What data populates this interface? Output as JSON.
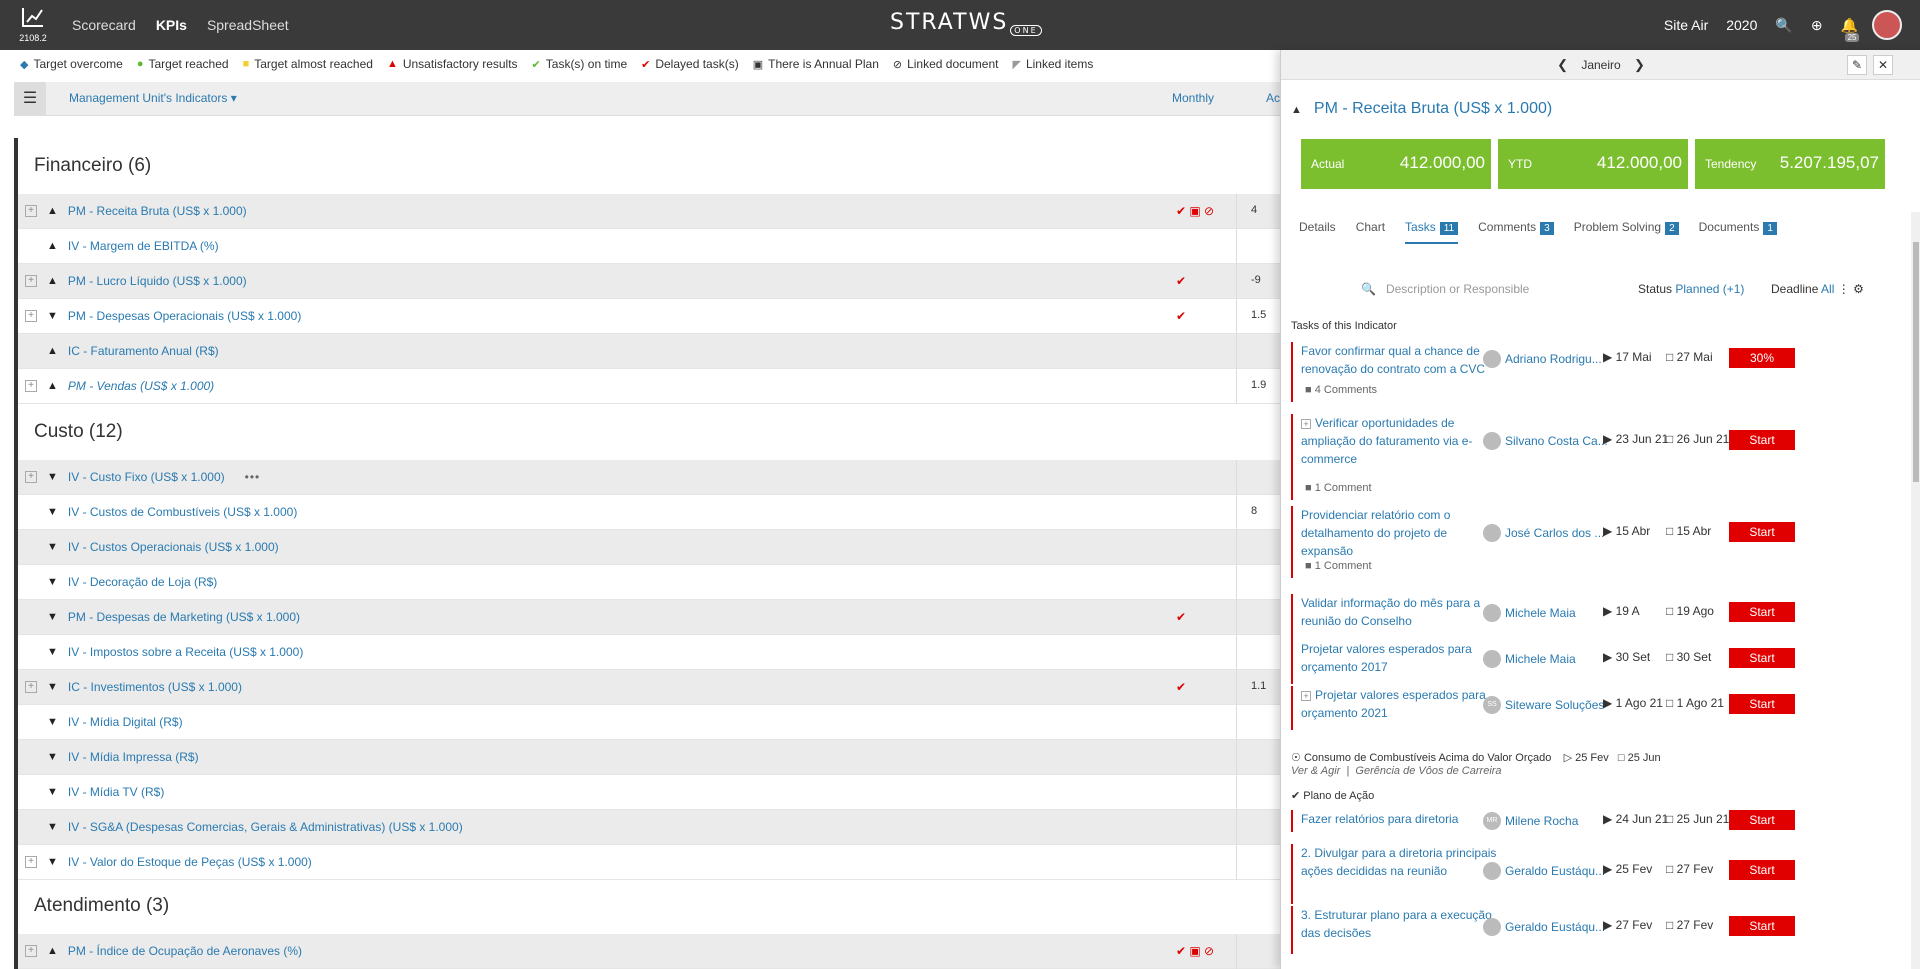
{
  "topbar": {
    "version": "2108.2",
    "nav": [
      "Scorecard",
      "KPIs",
      "SpreadSheet"
    ],
    "brand": "STRATWS",
    "brand_sub": "ONE",
    "site": "Site Air",
    "year": "2020",
    "notif_count": "25"
  },
  "legend": [
    {
      "icon": "◆",
      "color": "#2a7ab0",
      "label": "Target overcome"
    },
    {
      "icon": "●",
      "color": "#5cb82e",
      "label": "Target reached"
    },
    {
      "icon": "■",
      "color": "#f0d030",
      "label": "Target almost reached"
    },
    {
      "icon": "▲",
      "color": "#d00",
      "label": "Unsatisfactory results"
    },
    {
      "icon": "✔",
      "color": "#5cb82e",
      "label": "Task(s) on time"
    },
    {
      "icon": "✔",
      "color": "#d00",
      "label": "Delayed task(s)"
    },
    {
      "icon": "▣",
      "color": "#333",
      "label": "There is Annual Plan"
    },
    {
      "icon": "⊘",
      "color": "#333",
      "label": "Linked document"
    },
    {
      "icon": "◤",
      "color": "#999",
      "label": "Linked items"
    }
  ],
  "toolbar": {
    "unit": "Management Unit's Indicators",
    "period": "Monthly",
    "col": "Ac"
  },
  "sections": [
    {
      "title": "Financeiro (6)",
      "rows": [
        {
          "plus": true,
          "arrow": "▲",
          "name": "PM - Receita Bruta (US$ x 1.000)",
          "grey": true,
          "icons": "✔ ▣ ⊘",
          "val": "4"
        },
        {
          "plus": false,
          "arrow": "▲",
          "name": "IV - Margem de EBITDA (%)",
          "grey": false,
          "icons": "",
          "val": ""
        },
        {
          "plus": true,
          "arrow": "▲",
          "name": "PM - Lucro Líquido (US$ x 1.000)",
          "grey": true,
          "icons": "✔",
          "val": "-9"
        },
        {
          "plus": true,
          "arrow": "▼",
          "name": "PM - Despesas Operacionais (US$ x 1.000)",
          "grey": false,
          "icons": "✔",
          "val": "1.5"
        },
        {
          "plus": false,
          "arrow": "▲",
          "name": "IC - Faturamento Anual (R$)",
          "grey": true,
          "icons": "",
          "val": ""
        },
        {
          "plus": true,
          "arrow": "▲",
          "name": "PM - Vendas (US$ x 1.000)",
          "grey": false,
          "icons": "",
          "val": "1.9",
          "italic": true
        }
      ]
    },
    {
      "title": "Custo (12)",
      "rows": [
        {
          "plus": true,
          "arrow": "▼",
          "name": "IV - Custo Fixo (US$ x 1.000)",
          "grey": true,
          "icons": "",
          "val": "",
          "dots": "•••"
        },
        {
          "plus": false,
          "arrow": "▼",
          "name": "IV - Custos de Combustíveis (US$ x 1.000)",
          "grey": false,
          "icons": "",
          "val": "8"
        },
        {
          "plus": false,
          "arrow": "▼",
          "name": "IV - Custos Operacionais (US$ x 1.000)",
          "grey": true,
          "icons": "",
          "val": ""
        },
        {
          "plus": false,
          "arrow": "▼",
          "name": "IV - Decoração de Loja (R$)",
          "grey": false,
          "icons": "",
          "val": ""
        },
        {
          "plus": false,
          "arrow": "▼",
          "name": "PM - Despesas de Marketing (US$ x 1.000)",
          "grey": true,
          "icons": "✔",
          "val": ""
        },
        {
          "plus": false,
          "arrow": "▼",
          "name": "IV - Impostos sobre a Receita (US$ x 1.000)",
          "grey": false,
          "icons": "",
          "val": ""
        },
        {
          "plus": true,
          "arrow": "▼",
          "name": "IC - Investimentos (US$ x 1.000)",
          "grey": true,
          "icons": "✔",
          "val": "1.1"
        },
        {
          "plus": false,
          "arrow": "▼",
          "name": "IV - Mídia Digital (R$)",
          "grey": false,
          "icons": "",
          "val": ""
        },
        {
          "plus": false,
          "arrow": "▼",
          "name": "IV - Mídia Impressa (R$)",
          "grey": true,
          "icons": "",
          "val": ""
        },
        {
          "plus": false,
          "arrow": "▼",
          "name": "IV - Mídia TV (R$)",
          "grey": false,
          "icons": "",
          "val": ""
        },
        {
          "plus": false,
          "arrow": "▼",
          "name": "IV - SG&A (Despesas Comercias, Gerais & Administrativas) (US$ x 1.000)",
          "grey": true,
          "icons": "",
          "val": ""
        },
        {
          "plus": true,
          "arrow": "▼",
          "name": "IV - Valor do Estoque de Peças (US$ x 1.000)",
          "grey": false,
          "icons": "",
          "val": ""
        }
      ]
    },
    {
      "title": "Atendimento (3)",
      "rows": [
        {
          "plus": true,
          "arrow": "▲",
          "name": "PM - Índice de Ocupação de Aeronaves (%)",
          "grey": true,
          "icons": "✔ ▣ ⊘",
          "val": ""
        }
      ]
    }
  ],
  "panel": {
    "month": "Janeiro",
    "title": "PM - Receita Bruta (US$ x 1.000)",
    "kpis": [
      {
        "label": "Actual",
        "value": "412.000,00"
      },
      {
        "label": "YTD",
        "value": "412.000,00"
      },
      {
        "label": "Tendency",
        "value": "5.207.195,07"
      }
    ],
    "tabs": [
      {
        "label": "Details",
        "num": ""
      },
      {
        "label": "Chart",
        "num": ""
      },
      {
        "label": "Tasks",
        "num": "11"
      },
      {
        "label": "Comments",
        "num": "3"
      },
      {
        "label": "Problem Solving",
        "num": "2"
      },
      {
        "label": "Documents",
        "num": "1"
      }
    ],
    "search_placeholder": "Description or Responsible",
    "status_label": "Status",
    "status_value": "Planned (+1)",
    "deadline_label": "Deadline",
    "deadline_value": "All",
    "tasks_heading": "Tasks of this Indicator",
    "tasks": [
      {
        "title": "Favor confirmar qual a chance de renovação do contrato com a CVC",
        "who": "Adriano Rodrigu...",
        "start": "17 Mai",
        "end": "27 Mai",
        "btn": "30%",
        "comment": "4 Comments"
      },
      {
        "title": "Verificar oportunidades de ampliação do faturamento via e-commerce",
        "who": "Silvano Costa Ca...",
        "start": "23 Jun 21",
        "end": "26 Jun 21",
        "btn": "Start",
        "comment": "1 Comment",
        "plus": true
      },
      {
        "title": "Providenciar relatório com o detalhamento do projeto de expansão",
        "who": "José Carlos dos ...",
        "start": "15 Abr",
        "end": "15 Abr",
        "btn": "Start",
        "comment": "1 Comment"
      },
      {
        "title": "Validar informação do mês para a reunião do Conselho",
        "who": "Michele Maia",
        "start": "19 A",
        "end": "19 Ago",
        "btn": "Start",
        "comment": ""
      },
      {
        "title": "Projetar valores esperados para orçamento 2017",
        "who": "Michele Maia",
        "start": "30 Set",
        "end": "30 Set",
        "btn": "Start",
        "comment": ""
      },
      {
        "title": "Projetar valores esperados para orçamento 2021",
        "who": "Siteware Soluções",
        "start": "1 Ago 21",
        "end": "1 Ago 21",
        "btn": "Start",
        "comment": "",
        "plus": true,
        "initials": "SS"
      }
    ],
    "group": {
      "title": "Consumo de Combustíveis Acima do Valor Orçado",
      "start": "25 Fev",
      "end": "25 Jun",
      "sub1": "Ver & Agir",
      "sub2": "Gerência de Vôos de Carreira",
      "plan": "Plano de Ação"
    },
    "tasks2": [
      {
        "title": "Fazer relatórios para diretoria",
        "who": "Milene Rocha",
        "start": "24 Jun 21",
        "end": "25 Jun 21",
        "btn": "Start",
        "initials": "MR"
      },
      {
        "title": "2. Divulgar para a diretoria principais ações decididas na reunião",
        "who": "Geraldo Eustáqu...",
        "start": "25 Fev",
        "end": "27 Fev",
        "btn": "Start"
      },
      {
        "title": "3. Estruturar plano para a execução das decisões",
        "who": "Geraldo Eustáqu...",
        "start": "27 Fev",
        "end": "27 Fev",
        "btn": "Start"
      }
    ]
  }
}
